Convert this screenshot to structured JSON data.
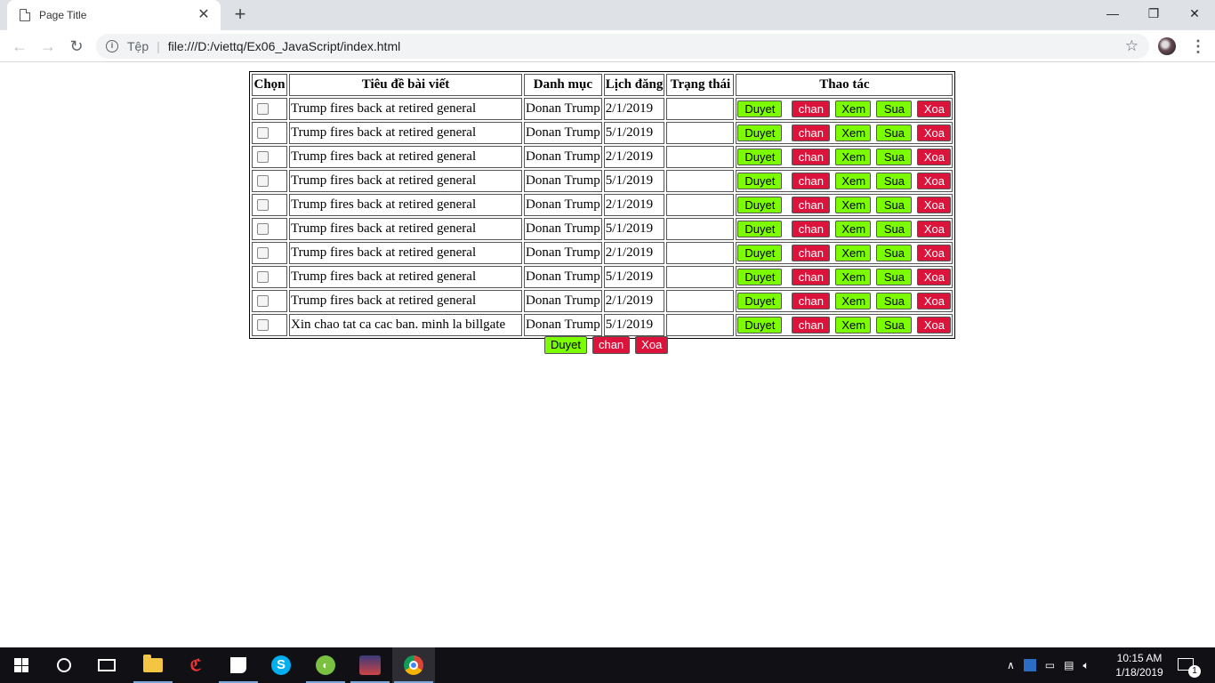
{
  "browser": {
    "tab_title": "Page Title",
    "tab_close": "✕",
    "new_tab": "+",
    "window_controls": {
      "minimize": "—",
      "restore": "❐",
      "close": "✕"
    },
    "nav": {
      "back": "←",
      "forward": "→",
      "reload": "↻"
    },
    "security_label": "Tệp",
    "url": "file:///D:/viettq/Ex06_JavaScript/index.html",
    "star": "☆",
    "menu": "⋮"
  },
  "table": {
    "headers": {
      "select": "Chọn",
      "title": "Tiêu đề bài viết",
      "category": "Danh mục",
      "schedule": "Lịch đăng",
      "status": "Trạng thái",
      "actions": "Thao tác"
    },
    "rows": [
      {
        "title": "Trump fires back at retired general",
        "category": "Donan Trump",
        "date": "2/1/2019",
        "status": ""
      },
      {
        "title": "Trump fires back at retired general",
        "category": "Donan Trump",
        "date": "5/1/2019",
        "status": ""
      },
      {
        "title": "Trump fires back at retired general",
        "category": "Donan Trump",
        "date": "2/1/2019",
        "status": ""
      },
      {
        "title": "Trump fires back at retired general",
        "category": "Donan Trump",
        "date": "5/1/2019",
        "status": ""
      },
      {
        "title": "Trump fires back at retired general",
        "category": "Donan Trump",
        "date": "2/1/2019",
        "status": ""
      },
      {
        "title": "Trump fires back at retired general",
        "category": "Donan Trump",
        "date": "5/1/2019",
        "status": ""
      },
      {
        "title": "Trump fires back at retired general",
        "category": "Donan Trump",
        "date": "2/1/2019",
        "status": ""
      },
      {
        "title": "Trump fires back at retired general",
        "category": "Donan Trump",
        "date": "5/1/2019",
        "status": ""
      },
      {
        "title": "Trump fires back at retired general",
        "category": "Donan Trump",
        "date": "2/1/2019",
        "status": ""
      },
      {
        "title": "Xin chao tat ca cac ban. minh la billgate",
        "category": "Donan Trump",
        "date": "5/1/2019",
        "status": ""
      }
    ],
    "row_actions": {
      "approve": "Duyet",
      "block": "chan",
      "view": "Xem",
      "edit": "Sua",
      "delete": "Xoa"
    }
  },
  "bulk_actions": {
    "approve": "Duyet",
    "block": "chan",
    "delete": "Xoa"
  },
  "colors": {
    "approve_bg": "#7cfc00",
    "danger_bg": "#dc143c"
  },
  "taskbar": {
    "icons": [
      "windows-start-icon",
      "search-circle-icon",
      "task-view-icon",
      "file-explorer-icon",
      "garena-icon",
      "sticky-notes-icon",
      "skype-icon",
      "coc-coc-icon",
      "game-icon",
      "chrome-icon"
    ],
    "clock_time": "10:15 AM",
    "clock_date": "1/18/2019",
    "notification_count": "1"
  }
}
